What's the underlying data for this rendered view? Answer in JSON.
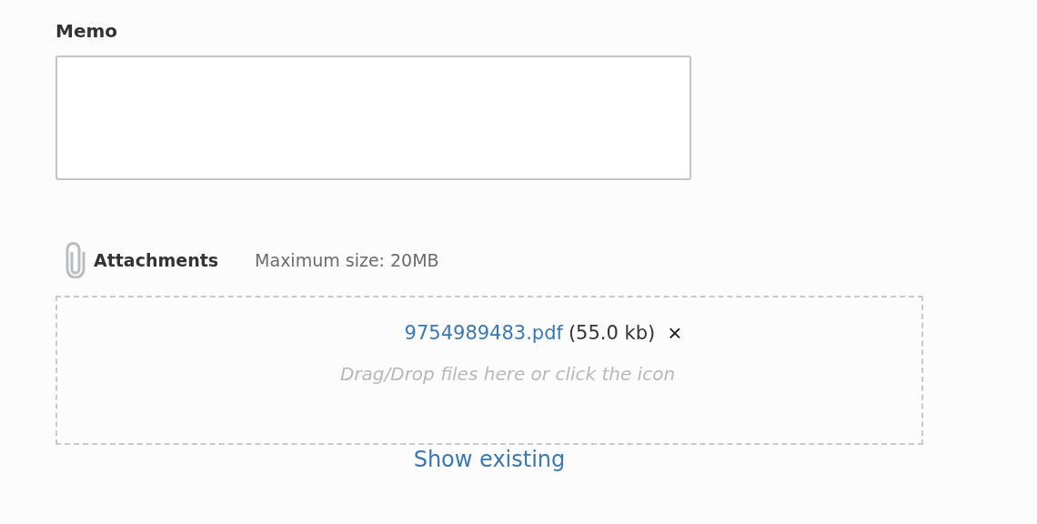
{
  "memo": {
    "label": "Memo"
  },
  "attachments": {
    "label": "Attachments",
    "max_size": "Maximum size: 20MB",
    "files": [
      {
        "name": "9754989483.pdf",
        "size": "(55.0 kb)",
        "remove": "×"
      }
    ],
    "hint": "Drag/Drop files here or click the icon",
    "show_existing": "Show existing"
  }
}
